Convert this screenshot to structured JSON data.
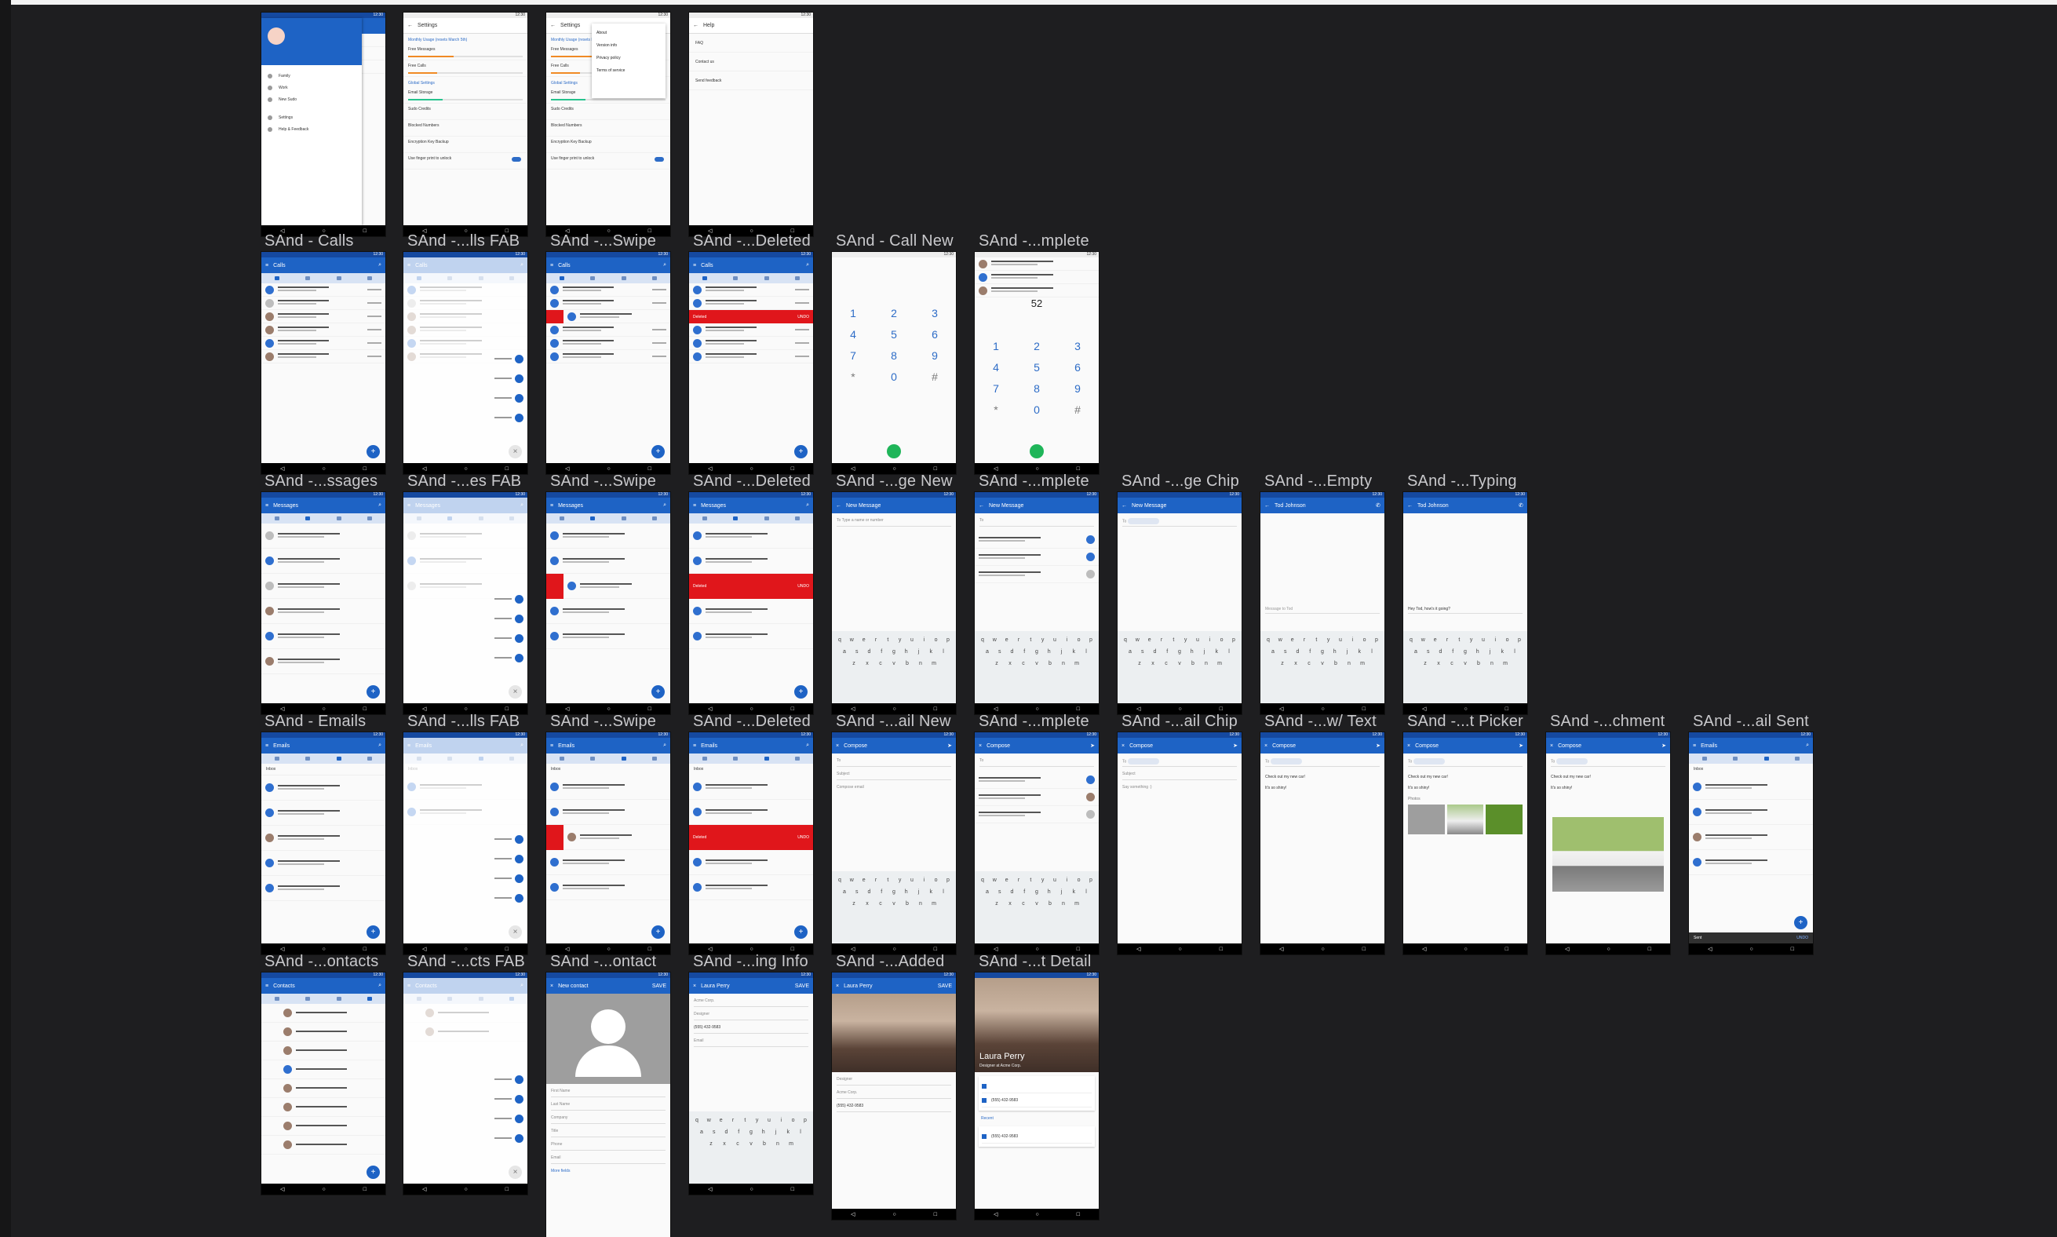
{
  "labels": {
    "r1": [
      "SAnd - Calls",
      "SAnd -...lls FAB",
      "SAnd -...Swipe",
      "SAnd -...Deleted",
      "SAnd - Call New",
      "SAnd -...mplete"
    ],
    "r2": [
      "SAnd -...ssages",
      "SAnd -...es FAB",
      "SAnd -...Swipe",
      "SAnd -...Deleted",
      "SAnd -...ge New",
      "SAnd -...mplete",
      "SAnd -...ge Chip",
      "SAnd -...Empty",
      "SAnd -...Typing"
    ],
    "r3": [
      "SAnd - Emails",
      "SAnd -...lls FAB",
      "SAnd -...Swipe",
      "SAnd -...Deleted",
      "SAnd -...ail New",
      "SAnd -...mplete",
      "SAnd -...ail Chip",
      "SAnd -...w/ Text",
      "SAnd -...t Picker",
      "SAnd -...chment",
      "SAnd -...ail Sent"
    ],
    "r4": [
      "SAnd -...ontacts",
      "SAnd -...cts FAB",
      "SAnd -...ontact",
      "SAnd -...ing Info",
      "SAnd -...Added",
      "SAnd -...t Detail"
    ]
  },
  "titles": {
    "settings": "Settings",
    "help": "Help",
    "calls": "Calls",
    "messages": "Messages",
    "new_message": "New Message",
    "emails": "Emails",
    "compose": "Compose",
    "contacts": "Contacts",
    "new_contact": "New contact",
    "tod": "Tod Johnson",
    "laura": "Laura Perry"
  },
  "settings": {
    "usage": "Monthly Usage (resets March 5th)",
    "free_messages": "Free Messages",
    "free_calls": "Free Calls",
    "global": "Global Settings",
    "email_storage": "Email Storage",
    "sudo_credits": "Sudo Credits",
    "blocked": "Blocked Numbers",
    "encryption": "Encryption Key Backup",
    "fingerprint": "Use finger print to unlock"
  },
  "menu": [
    "About",
    "Version info",
    "Privacy policy",
    "Terms of service"
  ],
  "help": [
    "FAQ",
    "Contact us",
    "Send feedback"
  ],
  "drawer": [
    "Friends",
    "Family",
    "Work",
    "New Sudo",
    "Settings",
    "Help & Feedback"
  ],
  "dialer": {
    "number": "52",
    "keys": [
      [
        "1",
        "2",
        "3"
      ],
      [
        "4",
        "5",
        "6"
      ],
      [
        "7",
        "8",
        "9"
      ],
      [
        "*",
        "0",
        "#"
      ]
    ]
  },
  "keyboard": [
    [
      "q",
      "w",
      "e",
      "r",
      "t",
      "y",
      "u",
      "i",
      "o",
      "p"
    ],
    [
      "a",
      "s",
      "d",
      "f",
      "g",
      "h",
      "j",
      "k",
      "l"
    ],
    [
      "z",
      "x",
      "c",
      "v",
      "b",
      "n",
      "m"
    ]
  ],
  "deleted": {
    "label": "Deleted",
    "undo": "UNDO"
  },
  "fab_labels": [
    "New Contact",
    "New Email",
    "New Message",
    "New Call"
  ],
  "message_prompts": {
    "to": "To",
    "name_or_number": "Type a name or number",
    "message_to": "Message to Tod",
    "typing": "Hey Tod, how's it going?"
  },
  "email": {
    "inbox": "Inbox",
    "to": "To",
    "subject": "Subject",
    "compose": "Compose email",
    "say": "Say something :)",
    "body1": "Check out my new car!",
    "body2": "It's so shiny!",
    "photos": "Photos",
    "sent": "Sent",
    "undo": "UNDO"
  },
  "contact": {
    "first": "First Name",
    "last": "Last Name",
    "company": "Company",
    "title": "Title",
    "phone": "Phone",
    "email": "Email",
    "more": "More fields",
    "save": "SAVE",
    "acme": "Acme Corp.",
    "designer": "Designer",
    "phone_value": "(555) 432-9583",
    "name_overlay": "Laura Perry",
    "subtitle": "Designer at Acme Corp.",
    "recent": "Recent"
  },
  "colors": {
    "primary": "#1e63c5",
    "danger": "#e0161b",
    "call": "#1fb559",
    "canvas": "#1e1e20"
  }
}
